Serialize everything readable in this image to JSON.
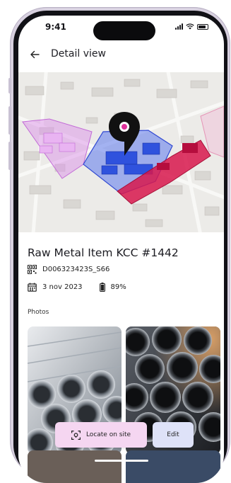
{
  "status_bar": {
    "time": "9:41"
  },
  "nav": {
    "title": "Detail view"
  },
  "map": {
    "pin_color": "#111111",
    "pin_dot_color": "#e0329c",
    "zone_colors": {
      "pink": "#d987e8",
      "blue": "#3f5fe0",
      "red": "#d8184c"
    }
  },
  "item": {
    "title": "Raw Metal Item KCC #1442",
    "code": "D006323423S_S66",
    "date": "3 nov 2023",
    "battery": "89%"
  },
  "photos": {
    "label": "Photos"
  },
  "actions": {
    "locate_label": "Locate on site",
    "edit_label": "Edit"
  },
  "colors": {
    "locate_bg": "#f5d6f1",
    "edit_bg": "#dee2f8"
  }
}
